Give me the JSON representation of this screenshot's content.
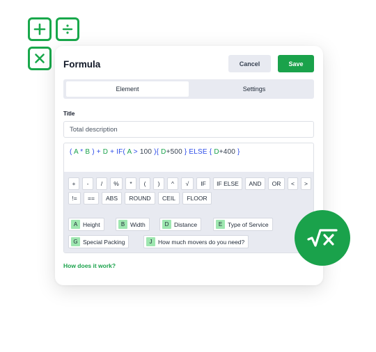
{
  "colors": {
    "accent": "#1aa24b",
    "operator": "#2b4be8",
    "panel": "#e8eaf1",
    "chip_letter_bg": "#9ee7b0"
  },
  "decor_icons": [
    "plus-icon",
    "divide-icon",
    "times-icon",
    "square-root-x-icon"
  ],
  "dialog": {
    "title": "Formula",
    "cancel_label": "Cancel",
    "save_label": "Save",
    "tabs": [
      {
        "label": "Element",
        "active": true
      },
      {
        "label": "Settings",
        "active": false
      }
    ],
    "title_field": {
      "label": "Title",
      "value": "Total description"
    },
    "formula": {
      "tokens": [
        "(",
        "A",
        "*",
        "B",
        ")",
        "+",
        "D",
        "+",
        "IF(",
        "A",
        ">",
        "100",
        "){",
        "D",
        "+500",
        "}",
        "ELSE",
        "{",
        "D",
        "+400",
        "}"
      ]
    },
    "operators_row1": [
      "+",
      "-",
      "/",
      "%",
      "*",
      "(",
      ")",
      "^",
      "√",
      "IF",
      "IF ELSE",
      "AND",
      "OR",
      "<",
      ">"
    ],
    "operators_row2": [
      "!=",
      "==",
      "ABS",
      "ROUND",
      "CEIL",
      "FLOOR"
    ],
    "variables": [
      {
        "letter": "A",
        "label": "Height"
      },
      {
        "letter": "B",
        "label": "Width"
      },
      {
        "letter": "D",
        "label": "Distance"
      },
      {
        "letter": "E",
        "label": "Type of Service"
      },
      {
        "letter": "G",
        "label": "Special Packing"
      },
      {
        "letter": "J",
        "label": "How much movers do you need?"
      }
    ],
    "help_link": "How does it work?"
  }
}
